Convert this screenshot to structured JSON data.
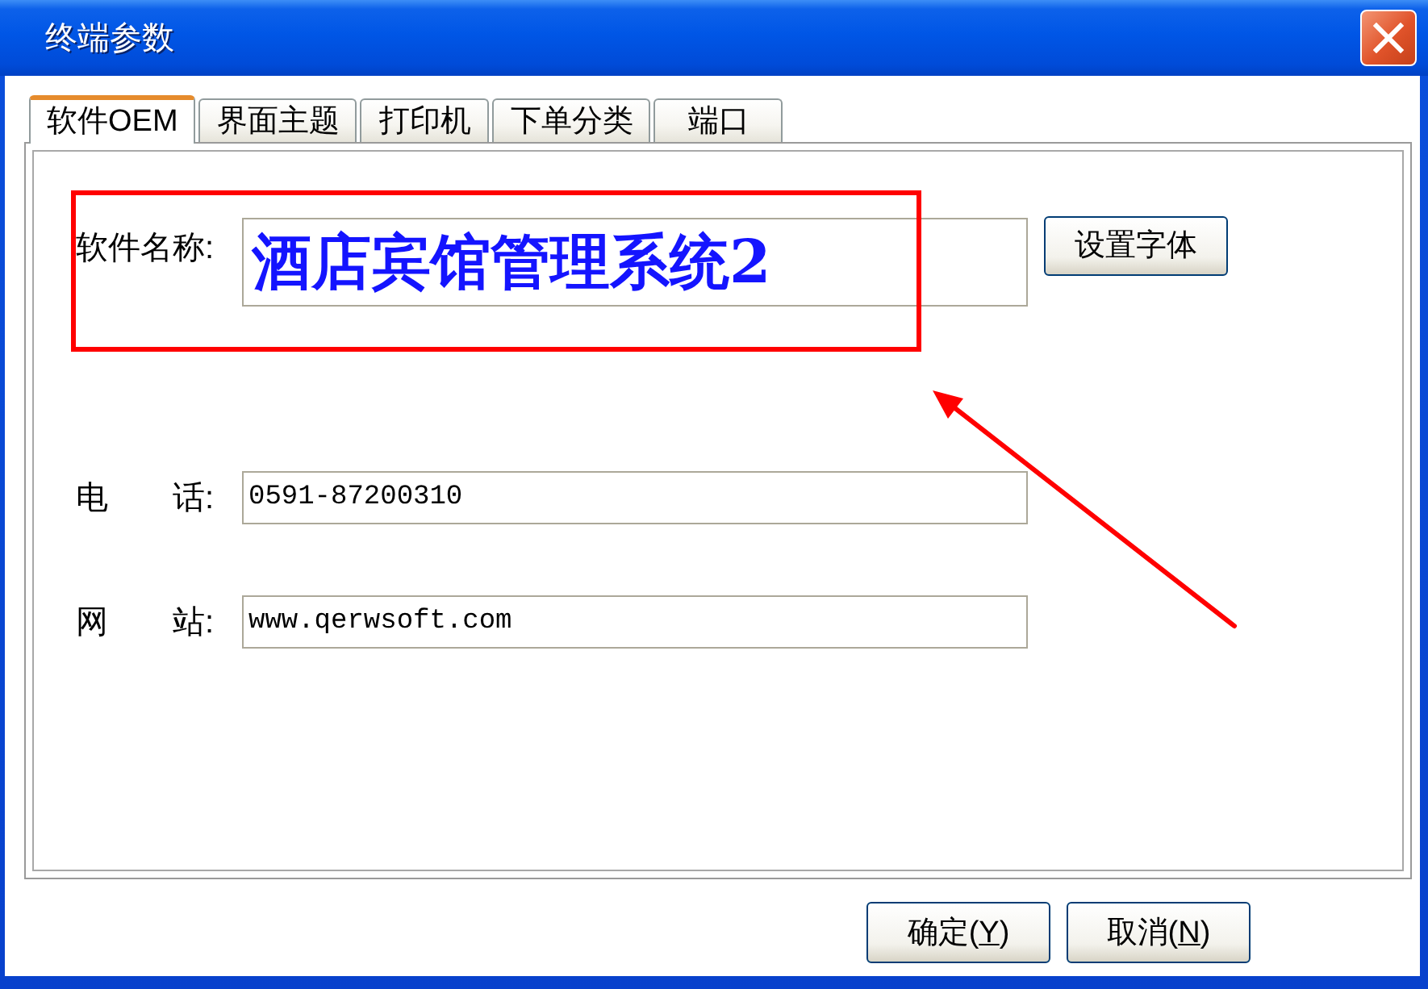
{
  "window": {
    "title": "终端参数"
  },
  "tabs": [
    {
      "label": "软件OEM",
      "selected": true
    },
    {
      "label": "界面主题",
      "selected": false
    },
    {
      "label": "打印机",
      "selected": false
    },
    {
      "label": "下单分类",
      "selected": false
    },
    {
      "label": "端口",
      "selected": false
    }
  ],
  "fields": [
    {
      "kind": "font_preview",
      "label": "软件名称:",
      "value": "酒店宾馆管理系统2",
      "button": "设置字体"
    },
    {
      "kind": "text",
      "label": "电　　话:",
      "value": "0591-87200310"
    },
    {
      "kind": "text",
      "label": "网　　站:",
      "value": "www.qerwsoft.com"
    }
  ],
  "buttons": [
    {
      "label": "确定(",
      "access_key": "Y",
      "label_end": ")"
    },
    {
      "label": "取消(",
      "access_key": "N",
      "label_end": ")"
    }
  ]
}
